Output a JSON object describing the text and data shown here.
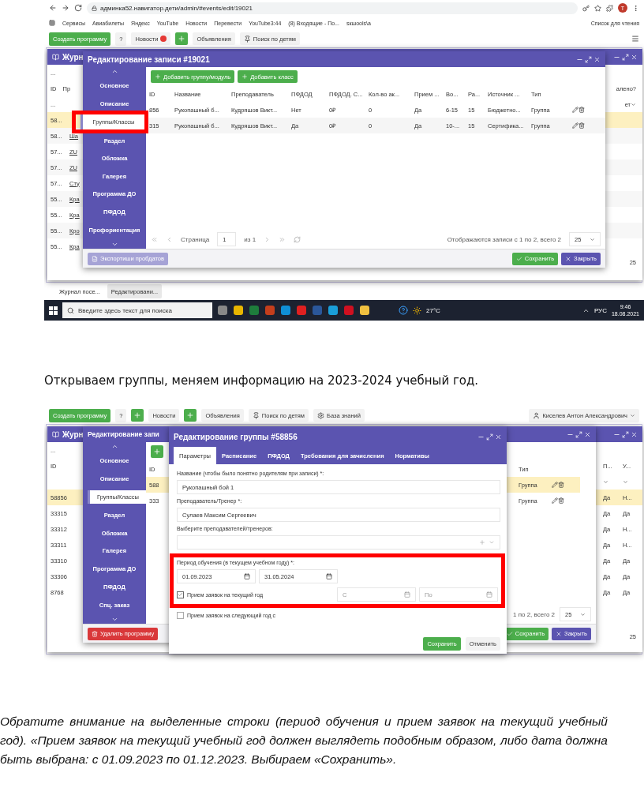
{
  "screenshot_1": {
    "browser": {
      "url": "админка52.навигатор.дети/admin/#events/edit/19021",
      "avatar": "T",
      "reading_list": "Список для чтения",
      "bookmarks": [
        "Сервисы",
        "Авиабилеты",
        "Яндекс",
        "YouTube",
        "Новости",
        "Перевести",
        "YouTube3:44",
        "(8) Входящие - По...",
        "sкшools\\a"
      ]
    },
    "toolbar": {
      "create": "Создать программу",
      "help": "?",
      "items": [
        {
          "kind": "badge",
          "label": "Новости"
        },
        {
          "kind": "plus",
          "label": "Объявления"
        },
        {
          "kind": "pin",
          "label": "Поиск по детям"
        }
      ]
    },
    "back_window": {
      "title": "Журн",
      "toolbar_button": "...",
      "columns": [
        "ID",
        "Пр"
      ],
      "right_column": "алено?",
      "filter": "...",
      "right_filter": "ет",
      "page_size": "25",
      "rows": [
        {
          "id": "58...",
          "name": "",
          "selected": true
        },
        {
          "id": "58...",
          "name": "Ша",
          "selected": false
        },
        {
          "id": "57...",
          "name": "ZU",
          "selected": false
        },
        {
          "id": "57...",
          "name": "ZU",
          "selected": false
        },
        {
          "id": "57...",
          "name": "Сту",
          "selected": false
        },
        {
          "id": "55...",
          "name": "Кра",
          "selected": false
        },
        {
          "id": "55...",
          "name": "Кра",
          "selected": false
        },
        {
          "id": "55...",
          "name": "Кро",
          "selected": false
        },
        {
          "id": "55...",
          "name": "Кра",
          "selected": false
        }
      ]
    },
    "modal": {
      "title": "Редактирование записи #19021",
      "sidebar": [
        {
          "label": "Основное",
          "selected": false,
          "highlighted": false
        },
        {
          "label": "Описание",
          "selected": false,
          "highlighted": false
        },
        {
          "label": "Группы/Классы",
          "selected": true,
          "highlighted": true
        },
        {
          "label": "Раздел",
          "selected": false,
          "highlighted": false
        },
        {
          "label": "Обложка",
          "selected": false,
          "highlighted": false
        },
        {
          "label": "Галерея",
          "selected": false,
          "highlighted": false
        },
        {
          "label": "Программа ДО",
          "selected": false,
          "highlighted": false
        },
        {
          "label": "ПФДОД",
          "selected": false,
          "highlighted": false
        },
        {
          "label": "Профориентация",
          "selected": false,
          "highlighted": false
        }
      ],
      "actions": [
        "Добавить группу/модуль",
        "Добавить класс"
      ],
      "columns": [
        "ID",
        "Название",
        "Преподаватель",
        "ПФДОД",
        "ПФДОД. С...",
        "Кол-во ак...",
        "Прием ...",
        "Во...",
        "Ра...",
        "Источник ...",
        "Тип"
      ],
      "rows": [
        [
          "856",
          "Рукопашный б...",
          "Кудряшов Викт...",
          "Нет",
          "0₽",
          "0",
          "Да",
          "6-15",
          "15",
          "Бюджетно...",
          "Группа"
        ],
        [
          "315",
          "Рукопашный б...",
          "Кудряшов Викт...",
          "Да",
          "0₽",
          "0",
          "Да",
          "10-...",
          "15",
          "Сертифика...",
          "Группа"
        ]
      ],
      "pager": {
        "label": "Страница",
        "page": "1",
        "of": "из 1",
        "summary": "Отображаются записи с 1 по 2, всего 2",
        "size": "25"
      },
      "export": "Экспортиши пробдатов",
      "save": "Сохранить",
      "close": "Закрыть"
    },
    "browser_tabs": [
      "Журнал посе...",
      "Редактировани..."
    ],
    "taskbar": {
      "search": "Введите здесь текст для поиска",
      "weather": "27°C",
      "lang": "РУС",
      "time": "9:46",
      "date": "18.08.2021"
    }
  },
  "caption": "Открываем группы, меняем информацию на 2023-2024 учебный год.",
  "screenshot_2": {
    "toolbar": {
      "create": "Создать программу",
      "help": "?",
      "items": [
        {
          "kind": "plus",
          "label": "Новости"
        },
        {
          "kind": "plus",
          "label": "Объявления"
        },
        {
          "kind": "pin",
          "label": "Поиск по детям"
        },
        {
          "kind": "gear",
          "label": "База знаний"
        }
      ],
      "user": "Киселев Антон Александрович"
    },
    "back_window": {
      "title": "Журн",
      "filter": "...",
      "column": "ID",
      "right_columns": [
        "П...",
        "У..."
      ],
      "page_size": "25",
      "rows": [
        {
          "id": "58856",
          "values": [
            "Да",
            "Н..."
          ],
          "selected": true
        },
        {
          "id": "33315",
          "values": [
            "Да",
            "Да"
          ],
          "selected": false
        },
        {
          "id": "33312",
          "values": [
            "Да",
            "Н..."
          ],
          "selected": false
        },
        {
          "id": "33311",
          "values": [
            "Да",
            "Н..."
          ],
          "selected": false
        },
        {
          "id": "33310",
          "values": [
            "Да",
            "Да"
          ],
          "selected": false
        },
        {
          "id": "33306",
          "values": [
            "Да",
            "Да"
          ],
          "selected": false
        },
        {
          "id": "8768",
          "values": [
            "Да",
            "Да"
          ],
          "selected": false
        }
      ]
    },
    "middle_window": {
      "title": "Редактирование запи",
      "sidebar": [
        {
          "label": "Основное",
          "selected": false
        },
        {
          "label": "Описание",
          "selected": false
        },
        {
          "label": "Группы/Классы",
          "selected": true
        },
        {
          "label": "Раздел",
          "selected": false
        },
        {
          "label": "Обложка",
          "selected": false
        },
        {
          "label": "Галерея",
          "selected": false
        },
        {
          "label": "Программа ДО",
          "selected": false
        },
        {
          "label": "ПФДОД",
          "selected": false
        },
        {
          "label": "Спц. заказ",
          "selected": false
        }
      ],
      "columns": [
        "ID",
        "Тип"
      ],
      "rows": [
        {
          "id": "588",
          "type": "Группа",
          "selected": true
        },
        {
          "id": "333",
          "type": "Группа",
          "selected": false
        }
      ],
      "summary": "1 по 2, всего 2",
      "size": "25",
      "delete": "Удалить программу",
      "save": "Сохранить",
      "close": "Закрыть"
    },
    "dialog": {
      "title": "Редактирование группы #58856",
      "tabs": [
        {
          "label": "Параметры",
          "selected": true
        },
        {
          "label": "Расписание",
          "selected": false
        },
        {
          "label": "ПФДОД",
          "selected": false
        },
        {
          "label": "Требования для зачисления",
          "selected": false
        },
        {
          "label": "Нормативы",
          "selected": false
        }
      ],
      "name_label": "Название (чтобы было понятно родителям при записи) *:",
      "name_value": "Рукопашный бой 1",
      "teacher_label": "Преподаватель/Тренер *:",
      "teacher_value": "Сулаев Максим Сергеевич",
      "teachers_label": "Выберите преподавателей/тренеров:",
      "period_highlighted": true,
      "period_label": "Период обучения (в текущем учебном году) *:",
      "period_start": "01.09.2023",
      "period_end": "31.05.2024",
      "checks": [
        {
          "label": "Прием заявок на текущий год",
          "checked": true,
          "from": "С",
          "to": "По"
        },
        {
          "label": "Прием заявок на следующий год с",
          "checked": false
        }
      ],
      "save": "Сохранить",
      "cancel": "Отменить"
    }
  },
  "note": "Обратите внимание на выделенные строки (период обучения и прием заявок на текущий учебный год). «Прием заявок на текущий учебный год должен выглядеть подобным образом, либо дата должна быть выбрана: с 01.09.2023 по 01.12.2023. Выбираем «Сохранить»."
}
